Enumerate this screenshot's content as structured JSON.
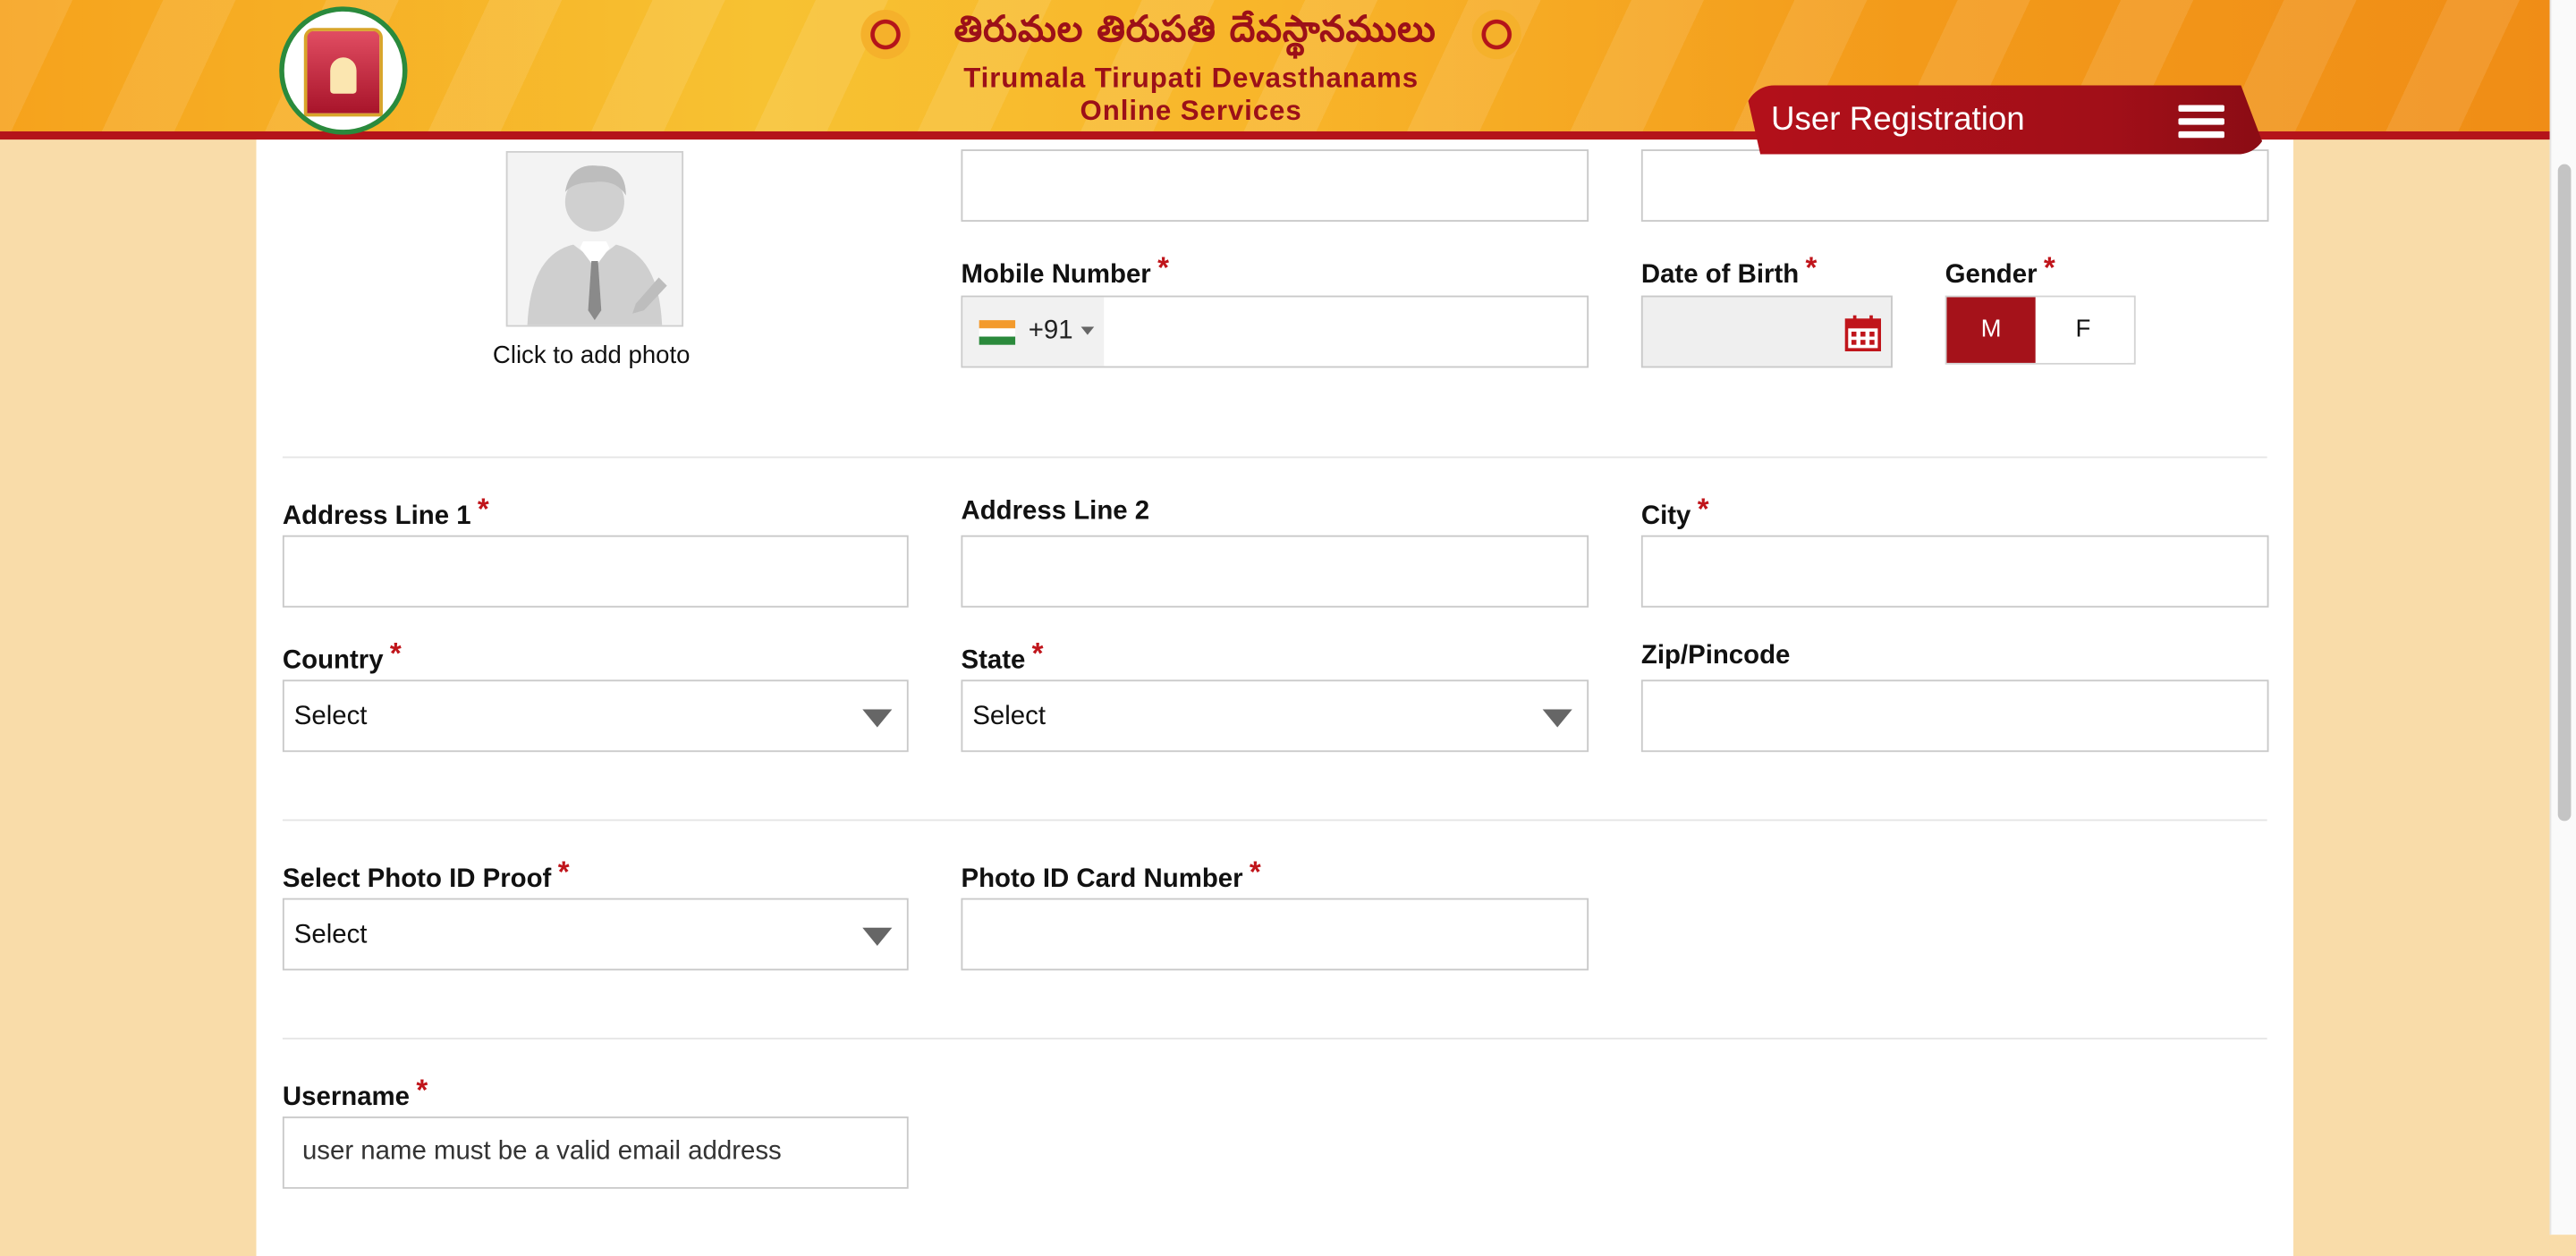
{
  "header": {
    "title_telugu": "తిరుమల తిరుపతి దేవస్థానములు",
    "title_en_line1": "Tirumala Tirupati Devasthanams",
    "title_en_line2": "Online Services",
    "page_tab": "User Registration"
  },
  "form": {
    "photo_caption": "Click to add photo",
    "mobile": {
      "label": "Mobile Number",
      "dial_code": "+91",
      "value": ""
    },
    "dob": {
      "label": "Date of Birth",
      "value": ""
    },
    "gender": {
      "label": "Gender",
      "options": [
        "M",
        "F"
      ],
      "selected": "M"
    },
    "address1": {
      "label": "Address Line 1",
      "value": ""
    },
    "address2": {
      "label": "Address Line 2",
      "value": ""
    },
    "city": {
      "label": "City",
      "value": ""
    },
    "country": {
      "label": "Country",
      "selected": "Select"
    },
    "state": {
      "label": "State",
      "selected": "Select"
    },
    "zip": {
      "label": "Zip/Pincode",
      "value": ""
    },
    "photo_id_proof": {
      "label": "Select Photo ID Proof",
      "selected": "Select"
    },
    "photo_id_number": {
      "label": "Photo ID Card Number",
      "value": ""
    },
    "username": {
      "label": "Username",
      "placeholder": "user name must be a valid email address"
    },
    "required_mark": "*"
  },
  "colors": {
    "brand_red": "#a5121a",
    "required": "#c0151b",
    "page_bg": "#f9dca9"
  }
}
